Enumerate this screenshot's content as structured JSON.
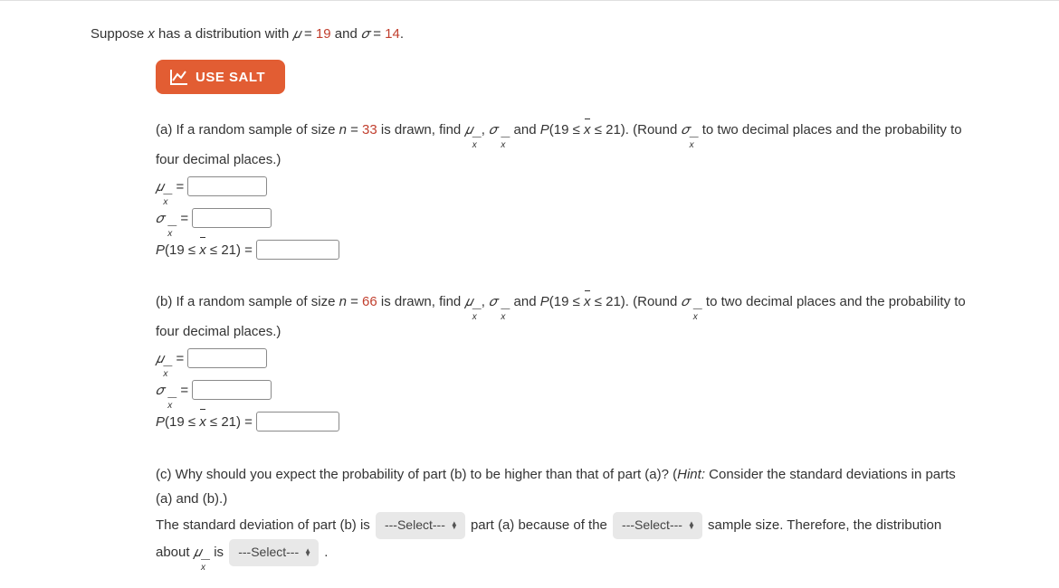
{
  "intro": {
    "prefix": "Suppose ",
    "var": "x",
    "mid1": " has a distribution with ",
    "mu": "𝜇",
    "eq1": " = ",
    "mu_val": "19",
    "mid2": " and ",
    "sigma": "𝜎",
    "eq2": " = ",
    "sigma_val": "14",
    "end": "."
  },
  "salt_label": "USE SALT",
  "part_a": {
    "text1": "(a) If a random sample of size ",
    "n": "n",
    "eq": " = ",
    "n_val": "33",
    "text2": " is drawn, find ",
    "comma": ", ",
    "text3": " and ",
    "prob_label": "P",
    "prob_cond": "(19 ≤ ",
    "prob_cond2": " ≤ 21)",
    "text4": ". (Round ",
    "text5": " to two decimal places and the probability to four decimal places.)",
    "mu_eq": " = ",
    "sigma_eq": " = ",
    "p_eq": " = "
  },
  "part_b": {
    "text1": "(b) If a random sample of size ",
    "n": "n",
    "eq": " = ",
    "n_val": "66",
    "text2": " is drawn, find ",
    "comma": ", ",
    "text3": " and ",
    "prob_label": "P",
    "prob_cond": "(19 ≤ ",
    "prob_cond2": " ≤ 21)",
    "text4": ". (Round ",
    "text5": " to two decimal places and the probability to four decimal places.)",
    "mu_eq": " = ",
    "sigma_eq": " = ",
    "p_eq": " = "
  },
  "part_c": {
    "line1a": "(c) Why should you expect the probability of part (b) to be higher than that of part (a)? (",
    "hint": "Hint:",
    "line1b": " Consider the standard deviations in parts (a) and (b).)",
    "line2a": "The standard deviation of part (b) is ",
    "select": "---Select---",
    "line2b": " part (a) because of the ",
    "line2c": " sample size. Therefore, the distribution about ",
    "line2d": " is ",
    "end": " ."
  }
}
